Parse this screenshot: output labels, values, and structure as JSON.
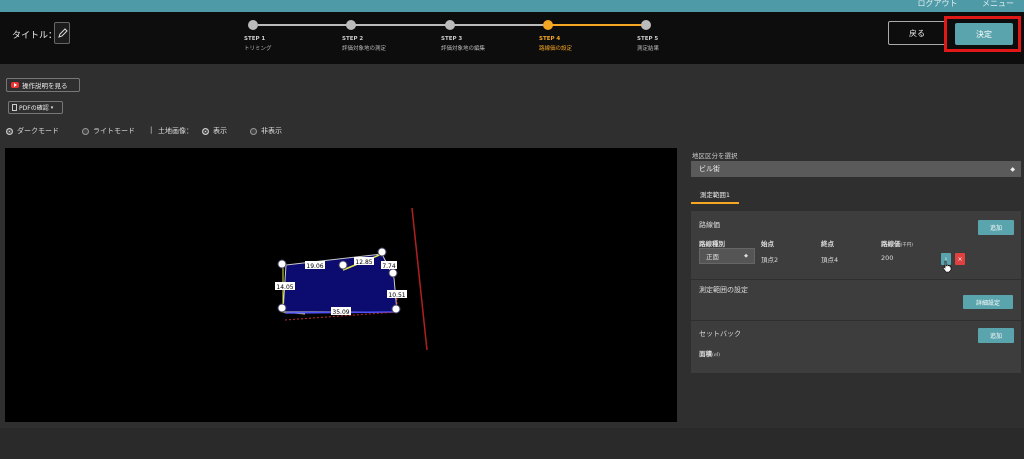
{
  "header": {
    "top_links": [
      "ログアウト",
      "メニュー"
    ],
    "title_label": "タイトル：",
    "steps": [
      {
        "num": "STEP 1",
        "label": "トリミング",
        "active": false
      },
      {
        "num": "STEP 2",
        "label": "評価対象地の測定",
        "active": false
      },
      {
        "num": "STEP 3",
        "label": "評価対象地の編集",
        "active": false
      },
      {
        "num": "STEP 4",
        "label": "路線価の設定",
        "active": true
      },
      {
        "num": "STEP 5",
        "label": "測定結果",
        "active": false
      }
    ],
    "back_label": "戻る",
    "confirm_label": "決定"
  },
  "toolbar": {
    "howto_label": "操作説明を見る",
    "pdf_label": "PDFの確認",
    "dark_mode": "ダークモード",
    "light_mode": "ライトモード",
    "separator": "|",
    "land_image_label": "土地画像：",
    "show": "表示",
    "hide": "非表示"
  },
  "canvas": {
    "labels": {
      "top1": "19.06",
      "top2": "12.85",
      "top3": "7.74",
      "left": "14.05",
      "right": "10.51",
      "bottom": "35.09"
    }
  },
  "sidebar": {
    "district_label": "地区区分を選択",
    "district_value": "ビル街",
    "tab_label": "測定範囲1",
    "road_price": {
      "title": "路線価",
      "add_label": "追加",
      "columns": [
        "路線種別",
        "始点",
        "終点",
        "路線価"
      ],
      "unit": "(千円)",
      "row": {
        "type": "正面",
        "start": "頂点2",
        "end": "頂点4",
        "price": "200"
      }
    },
    "range_settings": {
      "title": "測定範囲の設定",
      "detail_label": "詳細設定"
    },
    "setback": {
      "title": "セットバック",
      "add_label": "追加",
      "area_label": "面積",
      "area_unit": "(㎡)"
    }
  },
  "colors": {
    "accent": "#5aa4ad",
    "active_step": "#f5a623",
    "highlight": "#e01818",
    "delete": "#e04040"
  }
}
